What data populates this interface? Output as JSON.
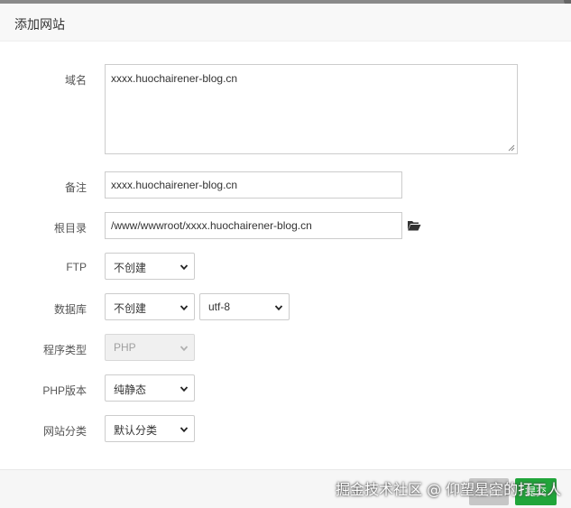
{
  "dialog": {
    "title": "添加网站"
  },
  "form": {
    "domain": {
      "label": "域名",
      "value": "xxxx.huochairener-blog.cn"
    },
    "remark": {
      "label": "备注",
      "value": "xxxx.huochairener-blog.cn"
    },
    "root_dir": {
      "label": "根目录",
      "value": "/www/wwwroot/xxxx.huochairener-blog.cn",
      "icon": "folder-open-icon"
    },
    "ftp": {
      "label": "FTP",
      "selected": "不创建"
    },
    "database": {
      "label": "数据库",
      "selected": "不创建",
      "charset": "utf-8"
    },
    "program_type": {
      "label": "程序类型",
      "selected": "PHP"
    },
    "php_version": {
      "label": "PHP版本",
      "selected": "纯静态"
    },
    "site_category": {
      "label": "网站分类",
      "selected": "默认分类"
    }
  },
  "footer": {
    "close_label": "关闭",
    "submit_label": "提交"
  },
  "watermark": "掘金技术社区 @ 仰望星空的打工人",
  "colors": {
    "submit": "#20a53a",
    "close": "#c6c6c6",
    "border": "#cccccc"
  }
}
